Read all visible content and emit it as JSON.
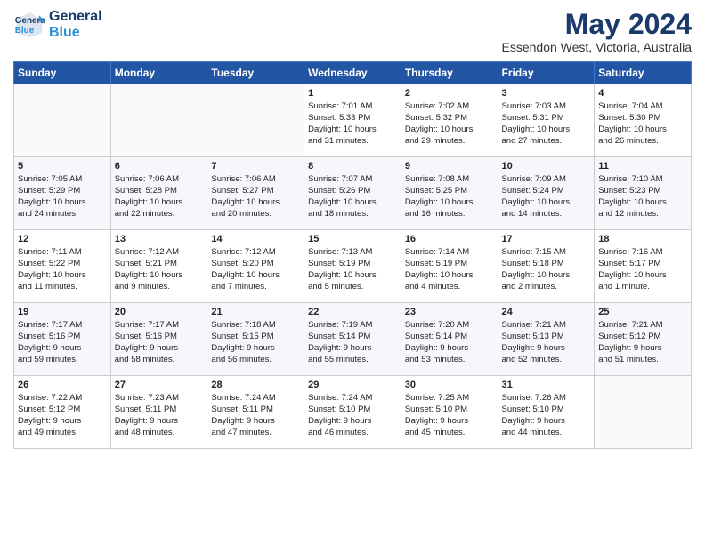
{
  "header": {
    "logo_line1": "General",
    "logo_line2": "Blue",
    "month": "May 2024",
    "location": "Essendon West, Victoria, Australia"
  },
  "days_of_week": [
    "Sunday",
    "Monday",
    "Tuesday",
    "Wednesday",
    "Thursday",
    "Friday",
    "Saturday"
  ],
  "weeks": [
    [
      {
        "day": "",
        "info": ""
      },
      {
        "day": "",
        "info": ""
      },
      {
        "day": "",
        "info": ""
      },
      {
        "day": "1",
        "info": "Sunrise: 7:01 AM\nSunset: 5:33 PM\nDaylight: 10 hours\nand 31 minutes."
      },
      {
        "day": "2",
        "info": "Sunrise: 7:02 AM\nSunset: 5:32 PM\nDaylight: 10 hours\nand 29 minutes."
      },
      {
        "day": "3",
        "info": "Sunrise: 7:03 AM\nSunset: 5:31 PM\nDaylight: 10 hours\nand 27 minutes."
      },
      {
        "day": "4",
        "info": "Sunrise: 7:04 AM\nSunset: 5:30 PM\nDaylight: 10 hours\nand 26 minutes."
      }
    ],
    [
      {
        "day": "5",
        "info": "Sunrise: 7:05 AM\nSunset: 5:29 PM\nDaylight: 10 hours\nand 24 minutes."
      },
      {
        "day": "6",
        "info": "Sunrise: 7:06 AM\nSunset: 5:28 PM\nDaylight: 10 hours\nand 22 minutes."
      },
      {
        "day": "7",
        "info": "Sunrise: 7:06 AM\nSunset: 5:27 PM\nDaylight: 10 hours\nand 20 minutes."
      },
      {
        "day": "8",
        "info": "Sunrise: 7:07 AM\nSunset: 5:26 PM\nDaylight: 10 hours\nand 18 minutes."
      },
      {
        "day": "9",
        "info": "Sunrise: 7:08 AM\nSunset: 5:25 PM\nDaylight: 10 hours\nand 16 minutes."
      },
      {
        "day": "10",
        "info": "Sunrise: 7:09 AM\nSunset: 5:24 PM\nDaylight: 10 hours\nand 14 minutes."
      },
      {
        "day": "11",
        "info": "Sunrise: 7:10 AM\nSunset: 5:23 PM\nDaylight: 10 hours\nand 12 minutes."
      }
    ],
    [
      {
        "day": "12",
        "info": "Sunrise: 7:11 AM\nSunset: 5:22 PM\nDaylight: 10 hours\nand 11 minutes."
      },
      {
        "day": "13",
        "info": "Sunrise: 7:12 AM\nSunset: 5:21 PM\nDaylight: 10 hours\nand 9 minutes."
      },
      {
        "day": "14",
        "info": "Sunrise: 7:12 AM\nSunset: 5:20 PM\nDaylight: 10 hours\nand 7 minutes."
      },
      {
        "day": "15",
        "info": "Sunrise: 7:13 AM\nSunset: 5:19 PM\nDaylight: 10 hours\nand 5 minutes."
      },
      {
        "day": "16",
        "info": "Sunrise: 7:14 AM\nSunset: 5:19 PM\nDaylight: 10 hours\nand 4 minutes."
      },
      {
        "day": "17",
        "info": "Sunrise: 7:15 AM\nSunset: 5:18 PM\nDaylight: 10 hours\nand 2 minutes."
      },
      {
        "day": "18",
        "info": "Sunrise: 7:16 AM\nSunset: 5:17 PM\nDaylight: 10 hours\nand 1 minute."
      }
    ],
    [
      {
        "day": "19",
        "info": "Sunrise: 7:17 AM\nSunset: 5:16 PM\nDaylight: 9 hours\nand 59 minutes."
      },
      {
        "day": "20",
        "info": "Sunrise: 7:17 AM\nSunset: 5:16 PM\nDaylight: 9 hours\nand 58 minutes."
      },
      {
        "day": "21",
        "info": "Sunrise: 7:18 AM\nSunset: 5:15 PM\nDaylight: 9 hours\nand 56 minutes."
      },
      {
        "day": "22",
        "info": "Sunrise: 7:19 AM\nSunset: 5:14 PM\nDaylight: 9 hours\nand 55 minutes."
      },
      {
        "day": "23",
        "info": "Sunrise: 7:20 AM\nSunset: 5:14 PM\nDaylight: 9 hours\nand 53 minutes."
      },
      {
        "day": "24",
        "info": "Sunrise: 7:21 AM\nSunset: 5:13 PM\nDaylight: 9 hours\nand 52 minutes."
      },
      {
        "day": "25",
        "info": "Sunrise: 7:21 AM\nSunset: 5:12 PM\nDaylight: 9 hours\nand 51 minutes."
      }
    ],
    [
      {
        "day": "26",
        "info": "Sunrise: 7:22 AM\nSunset: 5:12 PM\nDaylight: 9 hours\nand 49 minutes."
      },
      {
        "day": "27",
        "info": "Sunrise: 7:23 AM\nSunset: 5:11 PM\nDaylight: 9 hours\nand 48 minutes."
      },
      {
        "day": "28",
        "info": "Sunrise: 7:24 AM\nSunset: 5:11 PM\nDaylight: 9 hours\nand 47 minutes."
      },
      {
        "day": "29",
        "info": "Sunrise: 7:24 AM\nSunset: 5:10 PM\nDaylight: 9 hours\nand 46 minutes."
      },
      {
        "day": "30",
        "info": "Sunrise: 7:25 AM\nSunset: 5:10 PM\nDaylight: 9 hours\nand 45 minutes."
      },
      {
        "day": "31",
        "info": "Sunrise: 7:26 AM\nSunset: 5:10 PM\nDaylight: 9 hours\nand 44 minutes."
      },
      {
        "day": "",
        "info": ""
      }
    ]
  ]
}
